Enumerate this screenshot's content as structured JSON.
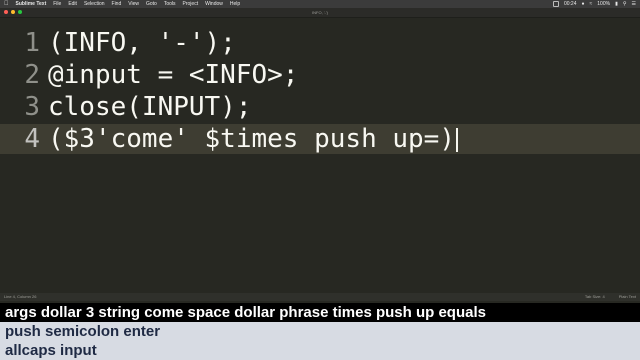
{
  "menubar": {
    "apple_icon": "apple-icon",
    "app_name": "Sublime Text",
    "items": [
      "File",
      "Edit",
      "Selection",
      "Find",
      "View",
      "Goto",
      "Tools",
      "Project",
      "Window",
      "Help"
    ],
    "clock": "00:24",
    "battery": "100%"
  },
  "window": {
    "title": "INFO, '-')",
    "tab_label": "INFO, '-')"
  },
  "editor": {
    "lines": [
      {
        "number": "1",
        "text": "(INFO, '-');"
      },
      {
        "number": "2",
        "text": "@input = <INFO>;"
      },
      {
        "number": "3",
        "text": "close(INPUT);"
      },
      {
        "number": "4",
        "text": "($3'come' $times push up=)"
      }
    ],
    "current_line": 4
  },
  "statusbar": {
    "position": "Line 4, Column 26",
    "tab_size": "Tab Size: 4",
    "syntax": "Plain Text"
  },
  "commands": [
    "args dollar 3 string come space dollar phrase times push up equals",
    "push semicolon enter",
    "allcaps input"
  ],
  "colors": {
    "editor_bg": "#272822",
    "current_line_bg": "#3e3d32",
    "text": "#f8f8f2",
    "gutter_text": "#8f908a",
    "command_highlight_bg": "#000000",
    "command_bg": "#d7dbe3"
  }
}
